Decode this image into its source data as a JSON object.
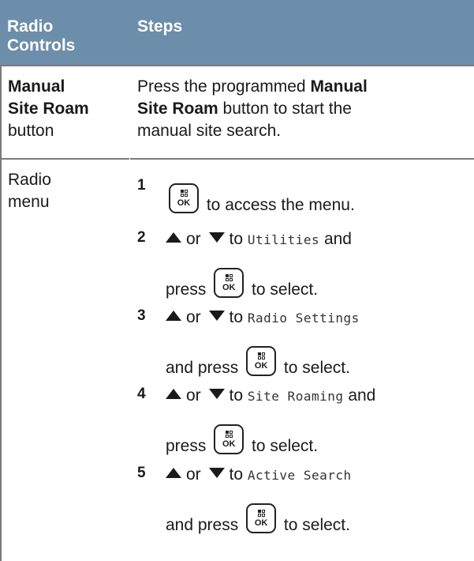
{
  "header": {
    "col1": "Radio Controls",
    "col1_line1": "Radio",
    "col1_line2": "Controls",
    "col2": "Steps"
  },
  "row1": {
    "control_line1": "Manual",
    "control_line2": "Site Roam",
    "control_line3": "button",
    "text_1": "Press the programmed ",
    "text_bold_1": "Manual",
    "text_bold_2": "Site Roam",
    "text_2": " button to start the",
    "text_3": "manual site search."
  },
  "row2": {
    "control_line1": "Radio",
    "control_line2": "menu",
    "steps": [
      {
        "num": "1",
        "after_ok": "to access the menu."
      },
      {
        "num": "2",
        "or": "or",
        "to": "to",
        "target": "Utilities",
        "and": "and",
        "press": "press",
        "to_select": "to select."
      },
      {
        "num": "3",
        "or": "or",
        "to": "to",
        "target": "Radio Settings",
        "and_press": "and press",
        "to_select": "to select."
      },
      {
        "num": "4",
        "or": "or",
        "to": "to",
        "target": "Site Roaming",
        "and": "and",
        "press": "press",
        "to_select": "to select."
      },
      {
        "num": "5",
        "or": "or",
        "to": "to",
        "target": "Active Search",
        "and_press": "and press",
        "to_select": "to select."
      }
    ]
  },
  "icons": {
    "ok_label": "OK",
    "menu_ok_icon": "menu-ok-button-icon",
    "up_icon": "up-arrow-icon",
    "down_icon": "down-arrow-icon"
  },
  "colors": {
    "header_bg": "#6d8eaa",
    "header_text": "#ffffff",
    "rule": "#7a7a7a"
  }
}
